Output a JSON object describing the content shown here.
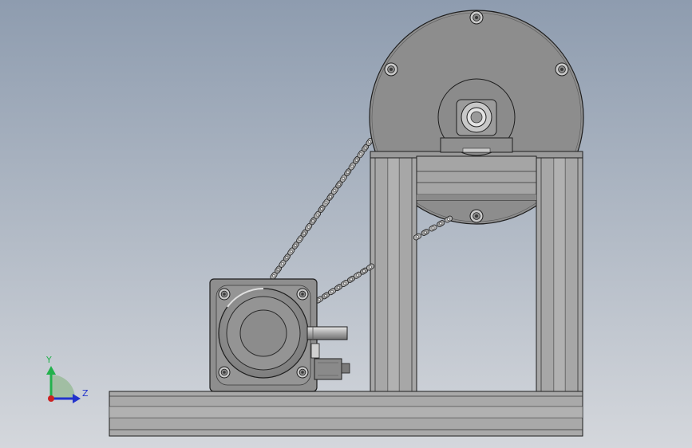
{
  "triad": {
    "y_label": "Y",
    "z_label": "Z",
    "y_color": "#22b14c",
    "z_color": "#2233cc",
    "x_color": "#cc2222"
  },
  "colors": {
    "background_top": "#8e9caf",
    "background_bottom": "#d4d7dc",
    "part_gray": "#8f8f8f",
    "extrusion_gray": "#a9a9a9",
    "edge": "#222222"
  }
}
